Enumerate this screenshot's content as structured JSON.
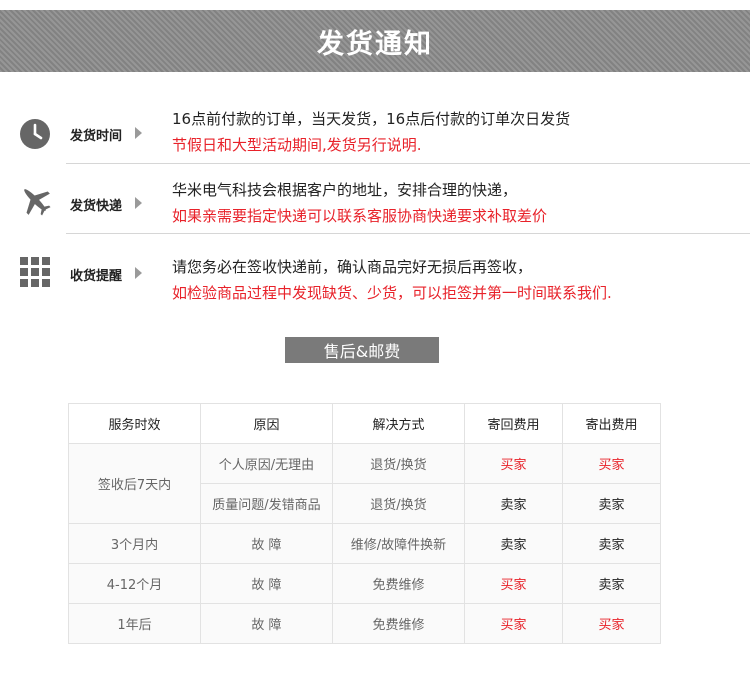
{
  "banner": {
    "title": "发货通知"
  },
  "info": [
    {
      "icon": "clock-icon",
      "label": "发货时间",
      "line1": "16点前付款的订单，当天发货，16点后付款的订单次日发货",
      "line2": "节假日和大型活动期间,发货另行说明."
    },
    {
      "icon": "airplane-icon",
      "label": "发货快递",
      "line1": "华米电气科技会根据客户的地址，安排合理的快递，",
      "line2": "如果亲需要指定快递可以联系客服协商快递要求补取差价"
    },
    {
      "icon": "grid-icon",
      "label": "收货提醒",
      "line1": "请您务必在签收快递前，确认商品完好无损后再签收，",
      "line2": "如检验商品过程中发现缺货、少货，可以拒签并第一时间联系我们."
    }
  ],
  "section": {
    "title": "售后&邮费"
  },
  "table": {
    "headers": [
      "服务时效",
      "原因",
      "解决方式",
      "寄回费用",
      "寄出费用"
    ],
    "rows": [
      {
        "period": "签收后7天内",
        "reason": "个人原因/无理由",
        "solution": "退货/换货",
        "return_fee": "买家",
        "send_fee": "买家"
      },
      {
        "period": "",
        "reason": "质量问题/发错商品",
        "solution": "退货/换货",
        "return_fee": "卖家",
        "send_fee": "卖家"
      },
      {
        "period": "3个月内",
        "reason": "故 障",
        "solution": "维修/故障件换新",
        "return_fee": "卖家",
        "send_fee": "卖家"
      },
      {
        "period": "4-12个月",
        "reason": "故 障",
        "solution": "免费维修",
        "return_fee": "买家",
        "send_fee": "卖家"
      },
      {
        "period": "1年后",
        "reason": "故 障",
        "solution": "免费维修",
        "return_fee": "买家",
        "send_fee": "买家"
      }
    ]
  },
  "colors": {
    "red": "#e8222a",
    "icon": "#666666",
    "banner": "#8a8a8a"
  }
}
